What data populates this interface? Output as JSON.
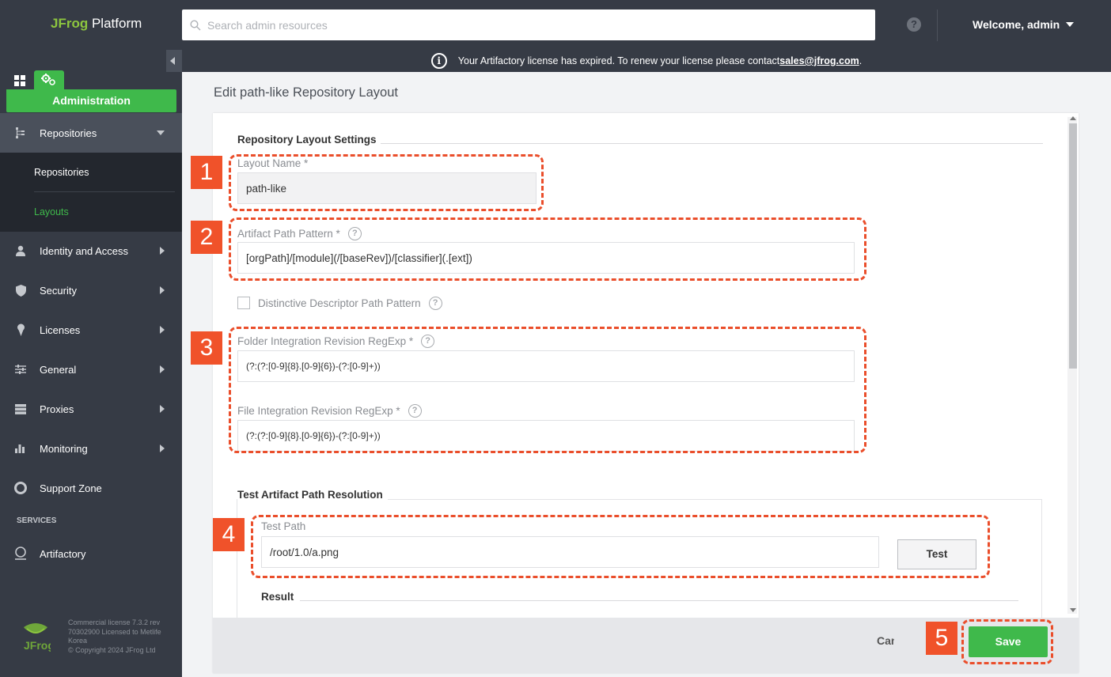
{
  "app": {
    "logo_brand": "JFrog",
    "logo_product": "Platform"
  },
  "search": {
    "placeholder": "Search admin resources"
  },
  "header": {
    "help_icon_label": "?",
    "welcome": "Welcome, admin"
  },
  "banner": {
    "message": "Your Artifactory license has expired. To renew your license please contact ",
    "link": "sales@jfrog.com",
    "suffix": "."
  },
  "sidebar": {
    "admin_label": "Administration",
    "repositories": {
      "label": "Repositories",
      "sub_items": [
        "Repositories",
        "Layouts"
      ],
      "selected": "Layouts"
    },
    "items": [
      {
        "label": "Identity and Access",
        "icon": "user-icon"
      },
      {
        "label": "Security",
        "icon": "shield-icon"
      },
      {
        "label": "Licenses",
        "icon": "license-icon"
      },
      {
        "label": "General",
        "icon": "sliders-icon"
      },
      {
        "label": "Proxies",
        "icon": "server-icon"
      },
      {
        "label": "Monitoring",
        "icon": "bar-chart-icon"
      },
      {
        "label": "Support Zone",
        "icon": "lifebuoy-icon"
      }
    ],
    "services_heading": "SERVICES",
    "services": [
      {
        "label": "Artifactory",
        "icon": "artifactory-icon"
      }
    ],
    "footer": [
      "Commercial license 7.3.2 rev",
      "70302900 Licensed to Metlife",
      "Korea",
      "© Copyright 2024 JFrog Ltd"
    ]
  },
  "page": {
    "title": "Edit path-like Repository Layout"
  },
  "form": {
    "settings_title": "Repository Layout Settings",
    "layout_name": {
      "label": "Layout Name *",
      "value": "path-like"
    },
    "artifact_path_pattern": {
      "label": "Artifact Path Pattern *",
      "value": "[orgPath]/[module](/[baseRev])/[classifier](.[ext])"
    },
    "distinctive_descriptor": {
      "label": "Distinctive Descriptor Path Pattern",
      "checked": false
    },
    "folder_regexp": {
      "label": "Folder Integration Revision RegExp *",
      "value": "(?:(?:[0-9]{8}.[0-9]{6})-(?:[0-9]+))"
    },
    "file_regexp": {
      "label": "File Integration Revision RegExp *",
      "value": "(?:(?:[0-9]{8}.[0-9]{6})-(?:[0-9]+))"
    },
    "test_title": "Test Artifact Path Resolution",
    "test_path": {
      "label": "Test Path",
      "value": "/root/1.0/a.png"
    },
    "test_button": "Test",
    "result_title": "Result"
  },
  "actions": {
    "cancel": "Cancel",
    "save": "Save"
  },
  "annotations": [
    "1",
    "2",
    "3",
    "4",
    "5"
  ],
  "colors": {
    "accent_green": "#3fb94b",
    "header_dark": "#363b45",
    "annotation_red": "#f0522a"
  }
}
